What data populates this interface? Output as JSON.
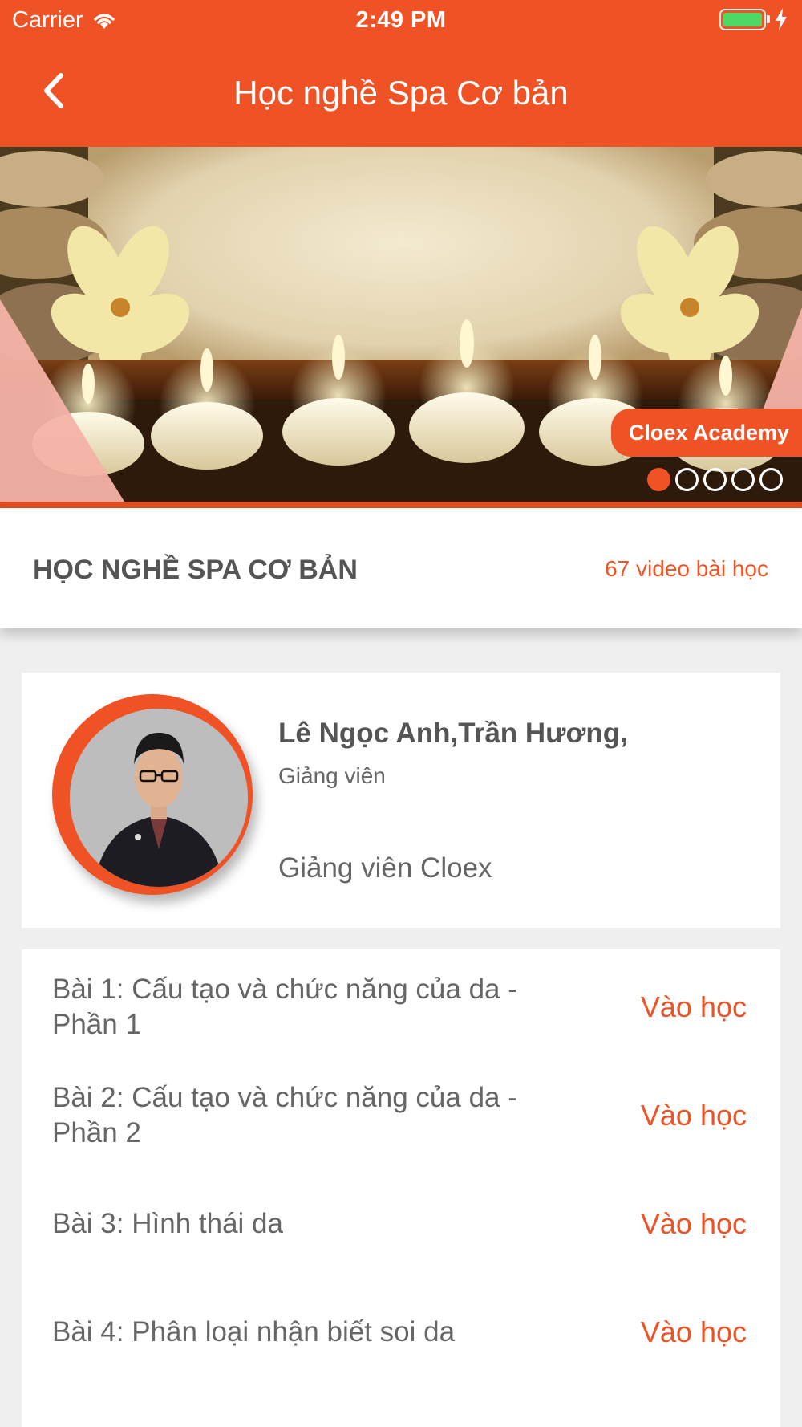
{
  "status_bar": {
    "carrier": "Carrier",
    "time": "2:49 PM"
  },
  "header": {
    "title": "Học nghề Spa Cơ bản"
  },
  "banner": {
    "tag": "Cloex Academy",
    "slides_total": 5,
    "active_slide": 1
  },
  "course": {
    "title": "HỌC NGHỀ SPA CƠ BẢN",
    "count": "67 video bài học"
  },
  "teacher": {
    "name": "Lê Ngọc Anh,Trần Hương,",
    "role": "Giảng viên",
    "description": "Giảng viên Cloex"
  },
  "lessons": [
    {
      "title": "Bài 1: Cấu tạo và chức năng của da - Phần 1",
      "action": "Vào học"
    },
    {
      "title": "Bài 2: Cấu tạo và chức năng của da - Phần 2",
      "action": "Vào học"
    },
    {
      "title": "Bài 3: Hình thái da",
      "action": "Vào học"
    },
    {
      "title": "Bài 4: Phân loại nhận biết soi da",
      "action": "Vào học"
    }
  ],
  "colors": {
    "accent": "#ef5325",
    "text": "#666666",
    "background": "#efefef"
  }
}
